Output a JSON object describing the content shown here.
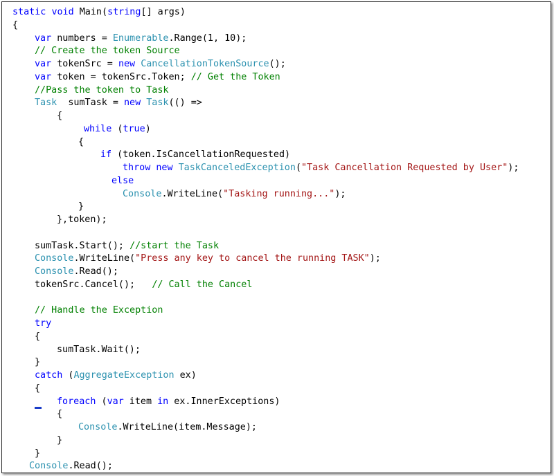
{
  "editor": {
    "colors": {
      "keyword": "#0000ff",
      "type": "#2b91af",
      "string": "#a31515",
      "comment": "#008000",
      "plain": "#000000"
    },
    "lines": [
      [
        [
          "k",
          "static"
        ],
        [
          "p",
          " "
        ],
        [
          "k",
          "void"
        ],
        [
          "p",
          " Main("
        ],
        [
          "k",
          "string"
        ],
        [
          "p",
          "[] args)"
        ]
      ],
      [
        [
          "p",
          "{"
        ]
      ],
      [
        [
          "k",
          "var"
        ],
        [
          "p",
          " numbers = "
        ],
        [
          "t",
          "Enumerable"
        ],
        [
          "p",
          ".Range(1, 10);"
        ]
      ],
      [
        [
          "c",
          "// Create the token Source"
        ]
      ],
      [
        [
          "k",
          "var"
        ],
        [
          "p",
          " tokenSrc = "
        ],
        [
          "k",
          "new"
        ],
        [
          "p",
          " "
        ],
        [
          "t",
          "CancellationTokenSource"
        ],
        [
          "p",
          "();"
        ]
      ],
      [
        [
          "k",
          "var"
        ],
        [
          "p",
          " token = tokenSrc.Token; "
        ],
        [
          "c",
          "// Get the Token"
        ]
      ],
      [
        [
          "c",
          "//Pass the token to Task"
        ]
      ],
      [
        [
          "t",
          "Task"
        ],
        [
          "p",
          "  sumTask = "
        ],
        [
          "k",
          "new"
        ],
        [
          "p",
          " "
        ],
        [
          "t",
          "Task"
        ],
        [
          "p",
          "(() =>"
        ]
      ],
      [
        [
          "p",
          "{"
        ]
      ],
      [
        [
          "k",
          "while"
        ],
        [
          "p",
          " ("
        ],
        [
          "k",
          "true"
        ],
        [
          "p",
          ")"
        ]
      ],
      [
        [
          "p",
          "{"
        ]
      ],
      [
        [
          "k",
          "if"
        ],
        [
          "p",
          " (token.IsCancellationRequested)"
        ]
      ],
      [
        [
          "k",
          "throw"
        ],
        [
          "p",
          " "
        ],
        [
          "k",
          "new"
        ],
        [
          "p",
          " "
        ],
        [
          "t",
          "TaskCanceledException"
        ],
        [
          "p",
          "("
        ],
        [
          "s",
          "\"Task Cancellation Requested by User\""
        ],
        [
          "p",
          ");"
        ]
      ],
      [
        [
          "k",
          "else"
        ]
      ],
      [
        [
          "t",
          "Console"
        ],
        [
          "p",
          ".WriteLine("
        ],
        [
          "s",
          "\"Tasking running...\""
        ],
        [
          "p",
          ");"
        ]
      ],
      [
        [
          "p",
          "}"
        ]
      ],
      [
        [
          "p",
          "},token);"
        ]
      ],
      [
        [
          "p",
          "sumTask.Start(); "
        ],
        [
          "c",
          "//start the Task"
        ]
      ],
      [
        [
          "t",
          "Console"
        ],
        [
          "p",
          ".WriteLine("
        ],
        [
          "s",
          "\"Press any key to cancel the running TASK\""
        ],
        [
          "p",
          ");"
        ]
      ],
      [
        [
          "t",
          "Console"
        ],
        [
          "p",
          ".Read();"
        ]
      ],
      [
        [
          "p",
          "tokenSrc.Cancel();   "
        ],
        [
          "c",
          "// Call the Cancel"
        ]
      ],
      [
        [
          "c",
          "// Handle the Exception"
        ]
      ],
      [
        [
          "k",
          "try"
        ]
      ],
      [
        [
          "p",
          "{"
        ]
      ],
      [
        [
          "p",
          "sumTask.Wait();"
        ]
      ],
      [
        [
          "p",
          "}"
        ]
      ],
      [
        [
          "k",
          "catch"
        ],
        [
          "p",
          " ("
        ],
        [
          "t",
          "AggregateException"
        ],
        [
          "p",
          " ex)"
        ]
      ],
      [
        [
          "p",
          "{"
        ]
      ],
      [
        [
          "k",
          "foreach"
        ],
        [
          "p",
          " ("
        ],
        [
          "k",
          "var"
        ],
        [
          "p",
          " item "
        ],
        [
          "k",
          "in"
        ],
        [
          "p",
          " ex.InnerExceptions)"
        ]
      ],
      [
        [
          "p",
          "{"
        ]
      ],
      [
        [
          "t",
          "Console"
        ],
        [
          "p",
          ".WriteLine(item.Message);"
        ]
      ],
      [
        [
          "p",
          "}"
        ]
      ],
      [
        [
          "p",
          "}"
        ]
      ],
      [
        [
          "t",
          "Console"
        ],
        [
          "p",
          ".Read();"
        ]
      ]
    ]
  }
}
